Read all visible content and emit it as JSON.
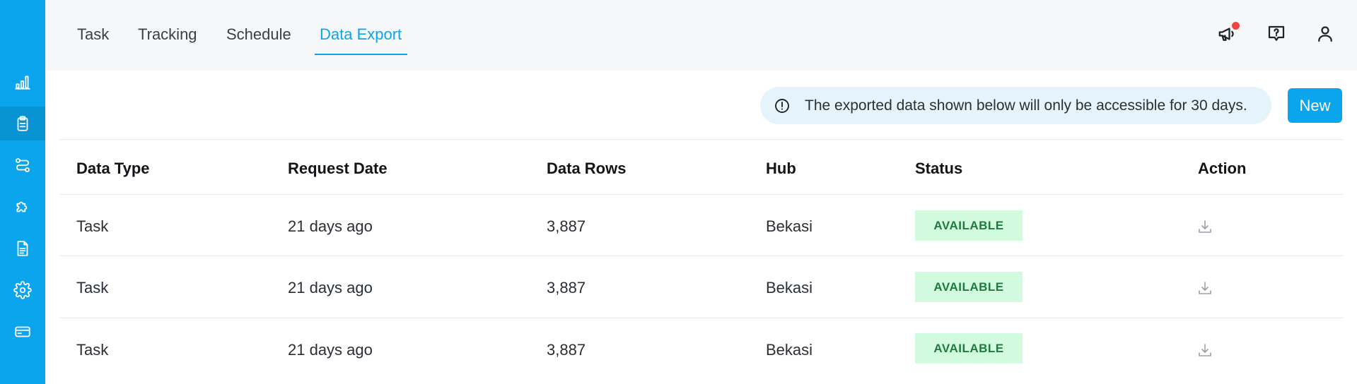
{
  "sidebar": {
    "items": [
      {
        "icon": "bar-chart-icon",
        "active": false
      },
      {
        "icon": "clipboard-icon",
        "active": true
      },
      {
        "icon": "route-icon",
        "active": false
      },
      {
        "icon": "puzzle-icon",
        "active": false
      },
      {
        "icon": "document-icon",
        "active": false
      },
      {
        "icon": "gear-icon",
        "active": false
      },
      {
        "icon": "credit-card-icon",
        "active": false
      }
    ]
  },
  "tabs": [
    {
      "label": "Task",
      "active": false
    },
    {
      "label": "Tracking",
      "active": false
    },
    {
      "label": "Schedule",
      "active": false
    },
    {
      "label": "Data Export",
      "active": true
    }
  ],
  "header_icons": [
    "megaphone-icon",
    "help-chat-icon",
    "user-icon"
  ],
  "banner": {
    "icon": "info-circle-icon",
    "text": "The exported data shown below will only be accessible for 30 days."
  },
  "new_button": {
    "label": "New"
  },
  "table": {
    "columns": [
      "Data Type",
      "Request Date",
      "Data Rows",
      "Hub",
      "Status",
      "Action"
    ],
    "rows": [
      {
        "data_type": "Task",
        "request_date": "21 days ago",
        "data_rows": "3,887",
        "hub": "Bekasi",
        "status": "AVAILABLE",
        "action_icon": "download-icon"
      },
      {
        "data_type": "Task",
        "request_date": "21 days ago",
        "data_rows": "3,887",
        "hub": "Bekasi",
        "status": "AVAILABLE",
        "action_icon": "download-icon"
      },
      {
        "data_type": "Task",
        "request_date": "21 days ago",
        "data_rows": "3,887",
        "hub": "Bekasi",
        "status": "AVAILABLE",
        "action_icon": "download-icon"
      }
    ]
  },
  "colors": {
    "accent": "#0aa5ec",
    "status_available_bg": "#d1fadf",
    "status_available_text": "#1f7a3e",
    "notification": "#ef4444"
  }
}
